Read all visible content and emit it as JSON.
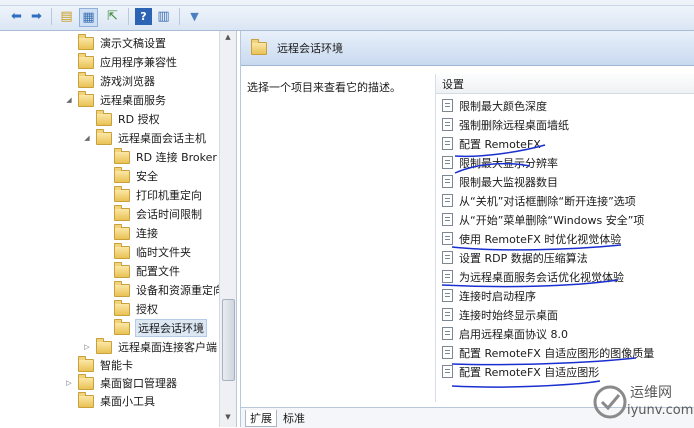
{
  "toolbar": {
    "buttons": [
      {
        "icon": "back-arrow-icon",
        "glyph": "⬅"
      },
      {
        "icon": "forward-arrow-icon",
        "glyph": "➡"
      },
      {
        "icon": "up-folder-icon",
        "glyph": "▤"
      },
      {
        "icon": "show-hide-tree-icon",
        "glyph": "▦"
      },
      {
        "icon": "export-list-icon",
        "glyph": "⇱"
      },
      {
        "icon": "help-icon",
        "glyph": "?"
      },
      {
        "icon": "properties-icon",
        "glyph": "▥"
      },
      {
        "icon": "filter-icon",
        "glyph": "▼"
      }
    ]
  },
  "tree": {
    "items": [
      {
        "label": "演示文稿设置",
        "expander": ""
      },
      {
        "label": "应用程序兼容性",
        "expander": ""
      },
      {
        "label": "游戏浏览器",
        "expander": ""
      },
      {
        "label": "远程桌面服务",
        "expander": "◢"
      },
      {
        "label": "RD 授权",
        "expander": ""
      },
      {
        "label": "远程桌面会话主机",
        "expander": "◢"
      },
      {
        "label": "RD 连接 Broker",
        "expander": ""
      },
      {
        "label": "安全",
        "expander": ""
      },
      {
        "label": "打印机重定向",
        "expander": ""
      },
      {
        "label": "会话时间限制",
        "expander": ""
      },
      {
        "label": "连接",
        "expander": ""
      },
      {
        "label": "临时文件夹",
        "expander": ""
      },
      {
        "label": "配置文件",
        "expander": ""
      },
      {
        "label": "设备和资源重定向",
        "expander": ""
      },
      {
        "label": "授权",
        "expander": ""
      },
      {
        "label": "远程会话环境",
        "expander": ""
      },
      {
        "label": "远程桌面连接客户端",
        "expander": "▷"
      },
      {
        "label": "智能卡",
        "expander": ""
      },
      {
        "label": "桌面窗口管理器",
        "expander": "▷"
      },
      {
        "label": "桌面小工具",
        "expander": ""
      }
    ]
  },
  "right": {
    "header_title": "远程会话环境",
    "description": "选择一个项目来查看它的描述。",
    "settings_header": "设置",
    "settings": [
      "限制最大颜色深度",
      "强制删除远程桌面墙纸",
      "配置 RemoteFX",
      "限制最大显示分辨率",
      "限制最大监视器数目",
      "从“关机”对话框删除“断开连接”选项",
      "从“开始”菜单删除“Windows 安全”项",
      "使用 RemoteFX 时优化视觉体验",
      "设置 RDP 数据的压缩算法",
      "为远程桌面服务会话优化视觉体验",
      "连接时启动程序",
      "连接时始终显示桌面",
      "启用远程桌面协议 8.0",
      "配置 RemoteFX 自适应图形的图像质量",
      "配置 RemoteFX 自适应图形"
    ],
    "tabs": [
      "扩展",
      "标准"
    ]
  },
  "watermark": {
    "line1": "运维网",
    "line2": "iyunv.com"
  }
}
